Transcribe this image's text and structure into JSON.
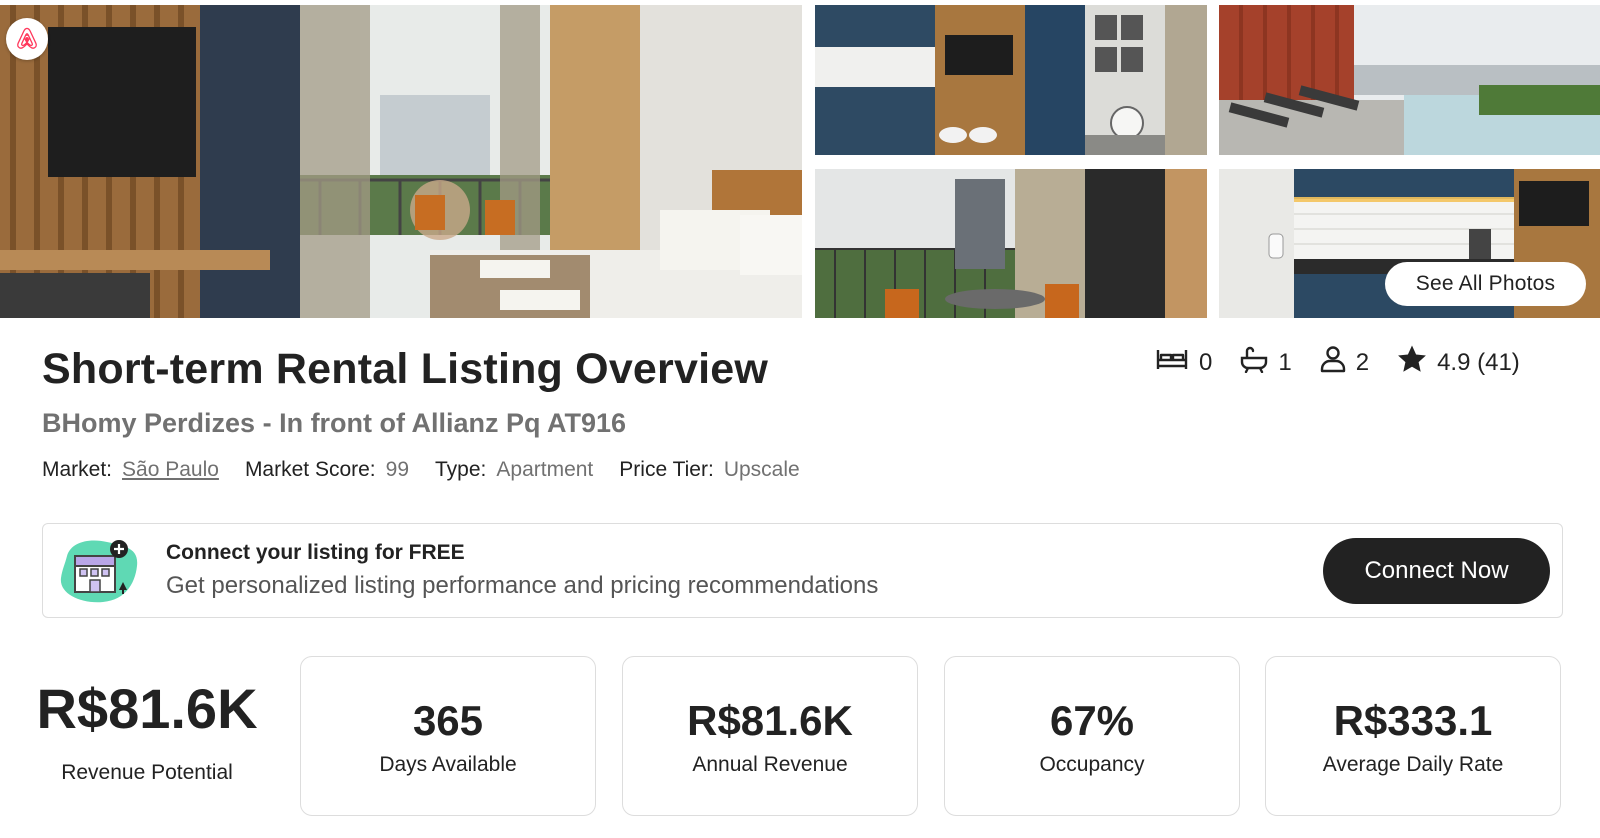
{
  "gallery": {
    "see_all_label": "See All Photos"
  },
  "listing": {
    "title": "Short-term Rental Listing Overview",
    "name": "BHomy Perdizes - In front of Allianz Pq AT916",
    "meta": [
      {
        "key": "Market:",
        "value": "São Paulo"
      },
      {
        "key": "Market Score:",
        "value": "99"
      },
      {
        "key": "Type:",
        "value": "Apartment"
      },
      {
        "key": "Price Tier:",
        "value": "Upscale"
      }
    ],
    "stats": {
      "bedrooms": "0",
      "bathrooms": "1",
      "guests": "2",
      "rating": "4.9 (41)"
    }
  },
  "banner": {
    "heading": "Connect your listing for FREE",
    "text": "Get personalized listing performance and pricing recommendations",
    "button_label": "Connect Now"
  },
  "metrics": {
    "revenue_potential": {
      "value": "R$81.6K",
      "label": "Revenue Potential"
    },
    "cards": [
      {
        "value": "365",
        "label": "Days Available"
      },
      {
        "value": "R$81.6K",
        "label": "Annual Revenue"
      },
      {
        "value": "67%",
        "label": "Occupancy"
      },
      {
        "value": "R$333.1",
        "label": "Average Daily Rate"
      }
    ]
  },
  "icons": {
    "bed": "bed-icon",
    "bath": "bathtub-icon",
    "guests": "person-icon",
    "rating": "star-icon",
    "brand": "airbnb-logo-icon"
  },
  "colors": {
    "brand": "#FF385C",
    "primary_text": "#222222",
    "secondary_text": "#717171",
    "button_dark": "#222222"
  }
}
